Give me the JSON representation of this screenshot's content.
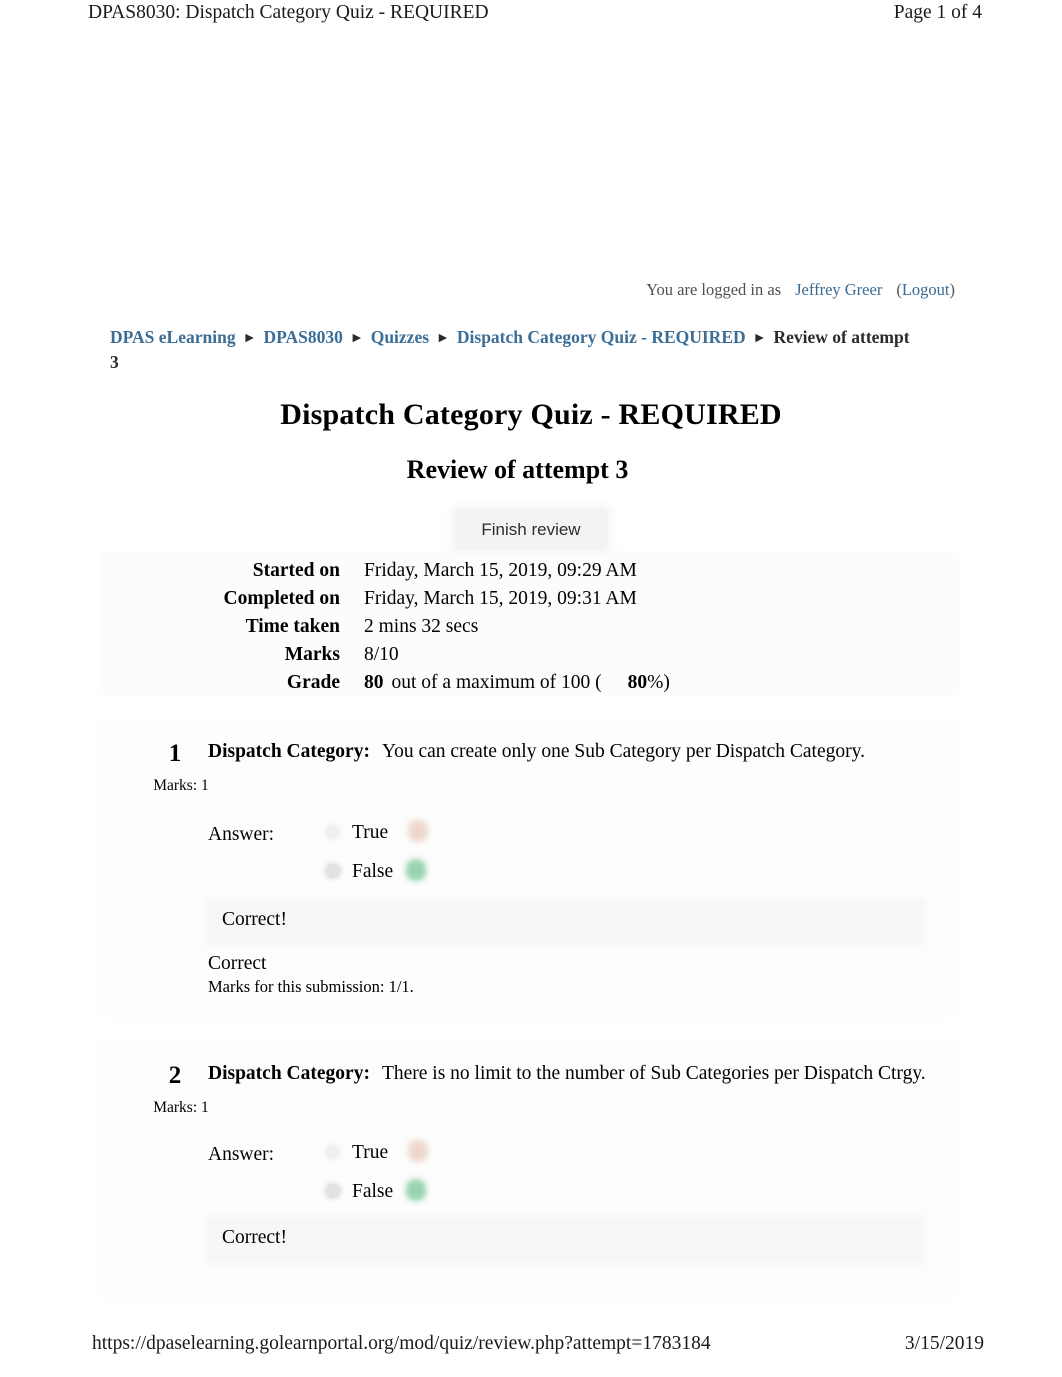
{
  "print_header": {
    "left": "DPAS8030: Dispatch Category Quiz - REQUIRED",
    "right": "Page 1 of 4"
  },
  "print_footer": {
    "url": "https://dpaselearning.golearnportal.org/mod/quiz/review.php?attempt=1783184",
    "date": "3/15/2019"
  },
  "logininfo": {
    "prefix": "You are logged in as",
    "username": "Jeffrey Greer",
    "paren_open": "(",
    "logout": "Logout",
    "paren_close": ")"
  },
  "breadcrumb": {
    "items": [
      {
        "label": "DPAS eLearning",
        "link": true
      },
      {
        "label": "DPAS8030",
        "link": true
      },
      {
        "label": "Quizzes",
        "link": true
      },
      {
        "label": "Dispatch Category Quiz - REQUIRED",
        "link": true
      },
      {
        "label": "Review of attempt 3",
        "link": false
      }
    ],
    "separator": "►"
  },
  "headings": {
    "title": "Dispatch Category Quiz - REQUIRED",
    "subtitle": "Review of attempt 3"
  },
  "actions": {
    "finish_review": "Finish review"
  },
  "summary": {
    "rows": [
      {
        "label": "Started on",
        "value": "Friday, March 15, 2019, 09:29 AM"
      },
      {
        "label": "Completed on",
        "value": "Friday, March 15, 2019, 09:31 AM"
      },
      {
        "label": "Time taken",
        "value": "2 mins 32 secs"
      },
      {
        "label": "Marks",
        "value": "8/10"
      }
    ],
    "grade": {
      "label": "Grade",
      "score": "80",
      "middle": "out of a maximum of 100 (",
      "percent": "80",
      "suffix": "%)"
    }
  },
  "questions": [
    {
      "number": "1",
      "marks": "Marks: 1",
      "category_label": "Dispatch Category:",
      "text": "You can create only one Sub Category per Dispatch Category.",
      "answer_label": "Answer:",
      "choices": [
        {
          "text": "True",
          "selected": false,
          "mark": "wrong"
        },
        {
          "text": "False",
          "selected": true,
          "mark": "right"
        }
      ],
      "feedback": "Correct!",
      "result": "Correct",
      "submission_marks": "Marks for this submission: 1/1."
    },
    {
      "number": "2",
      "marks": "Marks: 1",
      "category_label": "Dispatch Category:",
      "text": "There is no limit to the number of Sub Categories per Dispatch Ctrgy.",
      "answer_label": "Answer:",
      "choices": [
        {
          "text": "True",
          "selected": false,
          "mark": "wrong"
        },
        {
          "text": "False",
          "selected": true,
          "mark": "right"
        }
      ],
      "feedback": "Correct!"
    }
  ]
}
